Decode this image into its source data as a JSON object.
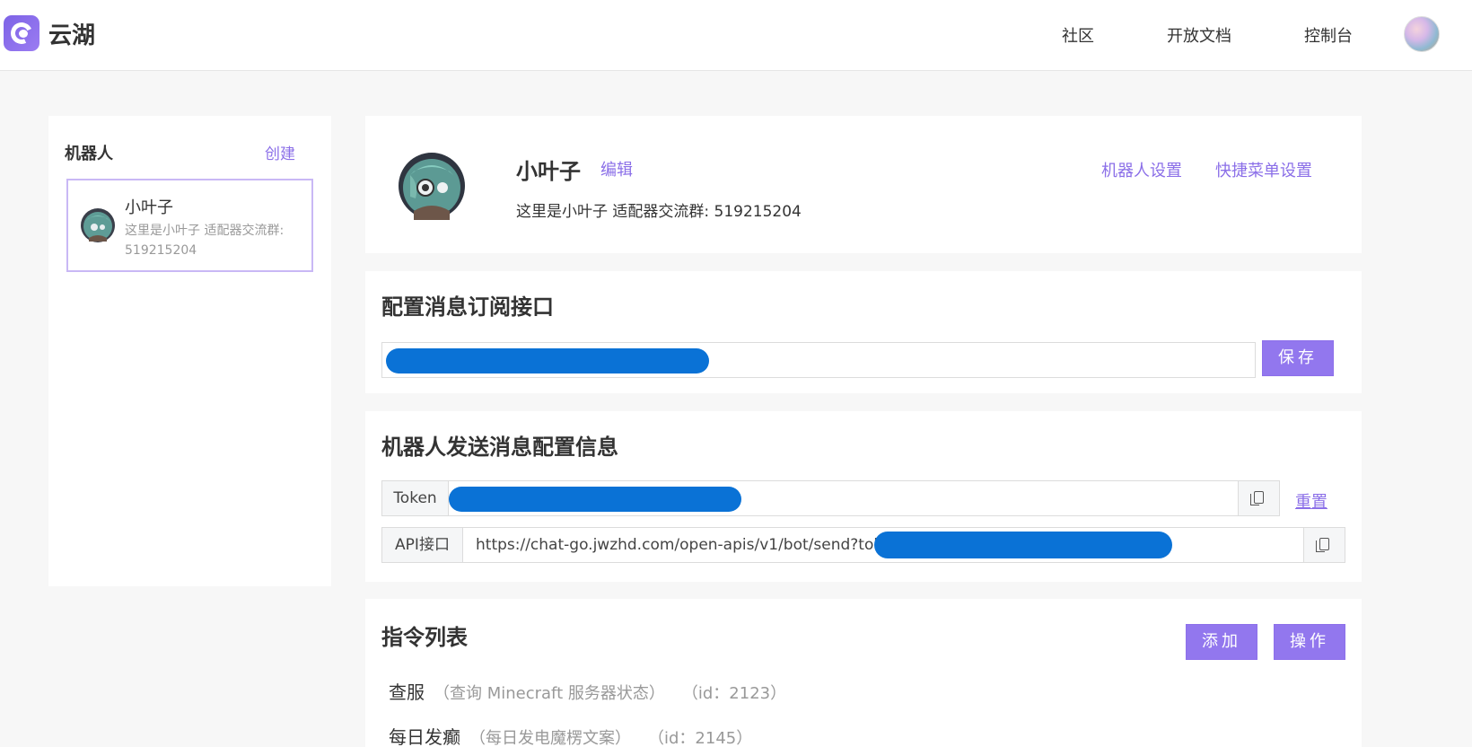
{
  "app": {
    "name": "云湖"
  },
  "nav": {
    "community": "社区",
    "docs": "开放文档",
    "console": "控制台"
  },
  "sidebar": {
    "title": "机器人",
    "create_label": "创建",
    "bots": [
      {
        "name": "小叶子",
        "description": "这里是小叶子 适配器交流群: 519215204"
      }
    ]
  },
  "bot_info": {
    "name": "小叶子",
    "edit_label": "编辑",
    "description": "这里是小叶子 适配器交流群: 519215204",
    "settings_label": "机器人设置",
    "menu_settings_label": "快捷菜单设置"
  },
  "subscription": {
    "title": "配置消息订阅接口",
    "save_label": "保存"
  },
  "send_config": {
    "title": "机器人发送消息配置信息",
    "token_label": "Token",
    "api_label": "API接口",
    "api_url_prefix": "https://chat-go.jwzhd.com/open-apis/v1/bot/send?token",
    "reset_label": "重置"
  },
  "commands": {
    "title": "指令列表",
    "add_label": "添加",
    "ops_label": "操作",
    "items": [
      {
        "name": "查服",
        "description": "（查询 Minecraft 服务器状态）",
        "id": "（id：2123）"
      },
      {
        "name": "每日发癫",
        "description": "（每日发电魔楞文案）",
        "id": "（id：2145）"
      }
    ]
  },
  "colors": {
    "accent": "#8b6fe8",
    "button": "#9277ee",
    "redaction": "#0a72d6"
  },
  "icons": {
    "copy": "copy-icon",
    "logo": "yunhu-logo-icon"
  }
}
